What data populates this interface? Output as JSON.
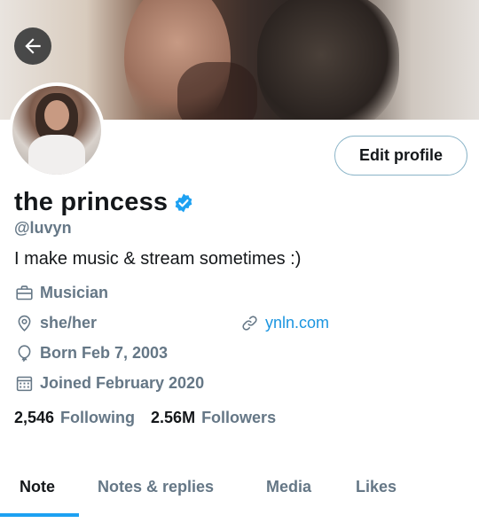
{
  "profile": {
    "display_name": "the princess",
    "handle": "@luvyn",
    "bio": "I make music & stream sometimes :)",
    "occupation": "Musician",
    "pronouns": "she/her",
    "website": "ynln.com",
    "birth": "Born Feb 7, 2003",
    "joined": "Joined February 2020",
    "verified": true
  },
  "actions": {
    "edit_profile_label": "Edit profile"
  },
  "stats": {
    "following_count": "2,546",
    "following_label": "Following",
    "followers_count": "2.56M",
    "followers_label": "Followers"
  },
  "tabs": [
    {
      "label": "Note",
      "active": true
    },
    {
      "label": "Notes & replies",
      "active": false
    },
    {
      "label": "Media",
      "active": false
    },
    {
      "label": "Likes",
      "active": false
    }
  ],
  "colors": {
    "accent": "#1da1f2",
    "link": "#1b95e0",
    "secondary_text": "#657786",
    "primary_text": "#14171a",
    "verified_badge": "#1da1f2"
  },
  "icons": {
    "back": "arrow-left-icon",
    "verified": "verified-badge-icon",
    "occupation": "briefcase-icon",
    "pronouns": "location-pin-icon",
    "website": "link-icon",
    "birth": "balloon-icon",
    "joined": "calendar-icon"
  }
}
